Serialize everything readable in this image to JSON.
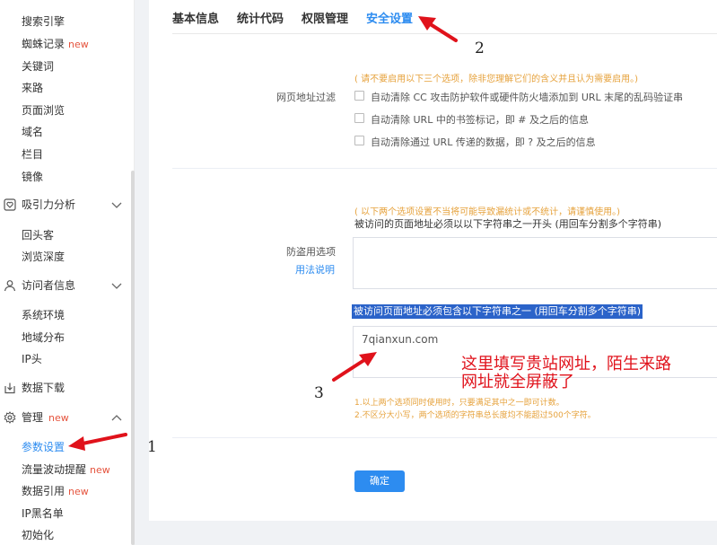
{
  "sidebar": {
    "items_top": [
      {
        "label": "搜索引擎"
      },
      {
        "label": "蜘蛛记录",
        "badge": "new"
      },
      {
        "label": "关键词"
      },
      {
        "label": "来路"
      },
      {
        "label": "页面浏览"
      },
      {
        "label": "域名"
      },
      {
        "label": "栏目"
      },
      {
        "label": "镜像"
      }
    ],
    "group_attraction": {
      "label": "吸引力分析",
      "icon": "heart-box-icon"
    },
    "items_attraction": [
      {
        "label": "回头客"
      },
      {
        "label": "浏览深度"
      }
    ],
    "group_visitor": {
      "label": "访问者信息",
      "icon": "user-icon"
    },
    "items_visitor": [
      {
        "label": "系统环境"
      },
      {
        "label": "地域分布"
      },
      {
        "label": "IP头"
      }
    ],
    "group_download": {
      "label": "数据下载",
      "icon": "download-icon"
    },
    "group_manage": {
      "label": "管理",
      "badge": "new",
      "icon": "gear-icon"
    },
    "items_manage": [
      {
        "label": "参数设置",
        "active": true
      },
      {
        "label": "流量波动提醒",
        "badge": "new"
      },
      {
        "label": "数据引用",
        "badge": "new"
      },
      {
        "label": "IP黑名单"
      },
      {
        "label": "初始化"
      }
    ]
  },
  "tabs": [
    {
      "label": "基本信息"
    },
    {
      "label": "统计代码"
    },
    {
      "label": "权限管理"
    },
    {
      "label": "安全设置",
      "active": true
    }
  ],
  "url_filter": {
    "warning": "( 请不要启用以下三个选项，除非您理解它们的含义并且认为需要启用。)",
    "label": "网页地址过滤",
    "options": [
      {
        "label": "自动清除 CC 攻击防护软件或硬件防火墙添加到 URL 末尾的乱码验证串",
        "checked": false
      },
      {
        "label": "自动清除 URL 中的书签标记，即 # 及之后的信息",
        "checked": false
      },
      {
        "label": "自动清除通过 URL 传递的数据，即 ? 及之后的信息",
        "checked": false
      }
    ]
  },
  "anti_theft": {
    "warning": "( 以下两个选项设置不当将可能导致漏统计或不统计，请谨慎使用。)",
    "prefix_desc": "被访问的页面地址必须以以下字符串之一开头 (用回车分割多个字符串)",
    "label": "防盗用选项",
    "usage_link": "用法说明",
    "prefix_value": "",
    "contains_desc": "被访问页面地址必须包含以下字符串之一 (用回车分割多个字符串)",
    "contains_value": "7qianxun.com",
    "tips": [
      "1.以上两个选项同时使用时，只要满足其中之一即可计数。",
      "2.不区分大小写，两个选项的字符串总长度均不能超过500个字符。"
    ]
  },
  "confirm_label": "确定",
  "annotations": {
    "num1": "1",
    "num2": "2",
    "num3": "3",
    "note_line1": "这里填写贵站网址，陌生来路",
    "note_line2": "网址就全屏蔽了",
    "colors": {
      "arrow": "#e0121b",
      "accent": "#2d8cf0",
      "warning": "#e6a23c",
      "new_badge": "#e5533d"
    }
  }
}
